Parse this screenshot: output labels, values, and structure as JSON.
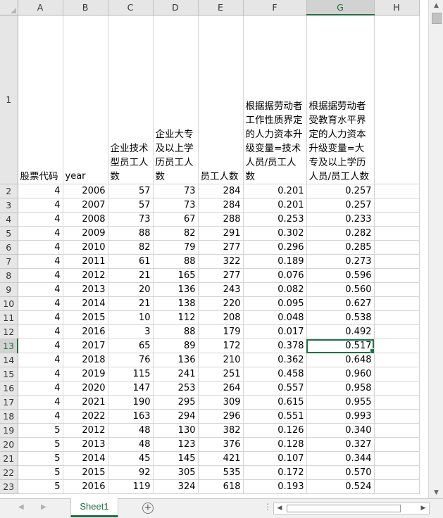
{
  "columns": [
    "A",
    "B",
    "C",
    "D",
    "E",
    "F",
    "G",
    "H"
  ],
  "selected_column": "G",
  "selected_row": "13",
  "header_row": {
    "row_num": "1",
    "cells": [
      "股票代码",
      "year",
      "企业技术型员工人数",
      "企业大专及以上学历员工人数",
      "员工人数",
      "根据据劳动者工作性质界定的人力资本升级变量=技术人员/员工人数",
      "根据据劳动者受教育水平界定的人力资本升级变量=大专及以上学历人员/员工人数",
      ""
    ]
  },
  "rows": [
    {
      "n": "2",
      "v": [
        "4",
        "2006",
        "57",
        "73",
        "284",
        "0.201",
        "0.257",
        ""
      ]
    },
    {
      "n": "3",
      "v": [
        "4",
        "2007",
        "57",
        "73",
        "284",
        "0.201",
        "0.257",
        ""
      ]
    },
    {
      "n": "4",
      "v": [
        "4",
        "2008",
        "73",
        "67",
        "288",
        "0.253",
        "0.233",
        ""
      ]
    },
    {
      "n": "5",
      "v": [
        "4",
        "2009",
        "88",
        "82",
        "291",
        "0.302",
        "0.282",
        ""
      ]
    },
    {
      "n": "6",
      "v": [
        "4",
        "2010",
        "82",
        "79",
        "277",
        "0.296",
        "0.285",
        ""
      ]
    },
    {
      "n": "7",
      "v": [
        "4",
        "2011",
        "61",
        "88",
        "322",
        "0.189",
        "0.273",
        ""
      ]
    },
    {
      "n": "8",
      "v": [
        "4",
        "2012",
        "21",
        "165",
        "277",
        "0.076",
        "0.596",
        ""
      ]
    },
    {
      "n": "9",
      "v": [
        "4",
        "2013",
        "20",
        "136",
        "243",
        "0.082",
        "0.560",
        ""
      ]
    },
    {
      "n": "10",
      "v": [
        "4",
        "2014",
        "21",
        "138",
        "220",
        "0.095",
        "0.627",
        ""
      ]
    },
    {
      "n": "11",
      "v": [
        "4",
        "2015",
        "10",
        "112",
        "208",
        "0.048",
        "0.538",
        ""
      ]
    },
    {
      "n": "12",
      "v": [
        "4",
        "2016",
        "3",
        "88",
        "179",
        "0.017",
        "0.492",
        ""
      ]
    },
    {
      "n": "13",
      "v": [
        "4",
        "2017",
        "65",
        "89",
        "172",
        "0.378",
        "0.517",
        ""
      ]
    },
    {
      "n": "14",
      "v": [
        "4",
        "2018",
        "76",
        "136",
        "210",
        "0.362",
        "0.648",
        ""
      ]
    },
    {
      "n": "15",
      "v": [
        "4",
        "2019",
        "115",
        "241",
        "251",
        "0.458",
        "0.960",
        ""
      ]
    },
    {
      "n": "16",
      "v": [
        "4",
        "2020",
        "147",
        "253",
        "264",
        "0.557",
        "0.958",
        ""
      ]
    },
    {
      "n": "17",
      "v": [
        "4",
        "2021",
        "190",
        "295",
        "309",
        "0.615",
        "0.955",
        ""
      ]
    },
    {
      "n": "18",
      "v": [
        "4",
        "2022",
        "163",
        "294",
        "296",
        "0.551",
        "0.993",
        ""
      ]
    },
    {
      "n": "19",
      "v": [
        "5",
        "2012",
        "48",
        "130",
        "382",
        "0.126",
        "0.340",
        ""
      ]
    },
    {
      "n": "20",
      "v": [
        "5",
        "2013",
        "48",
        "123",
        "376",
        "0.128",
        "0.327",
        ""
      ]
    },
    {
      "n": "21",
      "v": [
        "5",
        "2014",
        "45",
        "145",
        "421",
        "0.107",
        "0.344",
        ""
      ]
    },
    {
      "n": "22",
      "v": [
        "5",
        "2015",
        "92",
        "305",
        "535",
        "0.172",
        "0.570",
        ""
      ]
    },
    {
      "n": "23",
      "v": [
        "5",
        "2016",
        "119",
        "324",
        "618",
        "0.193",
        "0.524",
        ""
      ]
    }
  ],
  "sheet_tab": "Sheet1",
  "icons": {
    "nav_prev": "◀",
    "nav_next": "▶",
    "add_sheet": "+",
    "scroll_up": "▲",
    "scroll_down": "▼",
    "scroll_left": "◀",
    "scroll_right": "▶",
    "tab_menu": "⋮"
  },
  "colors": {
    "accent": "#1e7145"
  }
}
